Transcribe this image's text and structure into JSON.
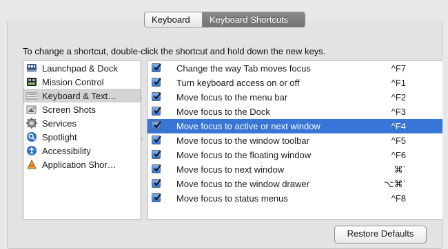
{
  "tabs": [
    {
      "label": "Keyboard",
      "active": false
    },
    {
      "label": "Keyboard Shortcuts",
      "active": true
    }
  ],
  "instructions": "To change a shortcut, double-click the shortcut and hold down the new keys.",
  "categories": [
    {
      "label": "Launchpad & Dock",
      "icon": "launchpad-icon"
    },
    {
      "label": "Mission Control",
      "icon": "mission-control-icon"
    },
    {
      "label": "Keyboard & Text…",
      "icon": "keyboard-icon",
      "selected": true
    },
    {
      "label": "Screen Shots",
      "icon": "screenshot-icon"
    },
    {
      "label": "Services",
      "icon": "gear-icon"
    },
    {
      "label": "Spotlight",
      "icon": "spotlight-icon"
    },
    {
      "label": "Accessibility",
      "icon": "accessibility-icon"
    },
    {
      "label": "Application Shor…",
      "icon": "app-shortcuts-icon"
    }
  ],
  "shortcuts": [
    {
      "name": "Change the way Tab moves focus",
      "key": "^F7",
      "checked": true
    },
    {
      "name": "Turn keyboard access on or off",
      "key": "^F1",
      "checked": true
    },
    {
      "name": "Move focus to the menu bar",
      "key": "^F2",
      "checked": true
    },
    {
      "name": "Move focus to the Dock",
      "key": "^F3",
      "checked": true
    },
    {
      "name": "Move focus to active or next window",
      "key": "^F4",
      "checked": true,
      "selected": true
    },
    {
      "name": "Move focus to the window toolbar",
      "key": "^F5",
      "checked": true
    },
    {
      "name": "Move focus to the floating window",
      "key": "^F6",
      "checked": true
    },
    {
      "name": "Move focus to next window",
      "key": "⌘`",
      "checked": true
    },
    {
      "name": "Move focus to the window drawer",
      "key": "⌥⌘`",
      "checked": true
    },
    {
      "name": "Move focus to status menus",
      "key": "^F8",
      "checked": true
    }
  ],
  "restore_label": "Restore Defaults",
  "colors": {
    "selection": "#3875d7",
    "checkbox": "#2e72d2",
    "category_selected": "#d4d4d4"
  }
}
